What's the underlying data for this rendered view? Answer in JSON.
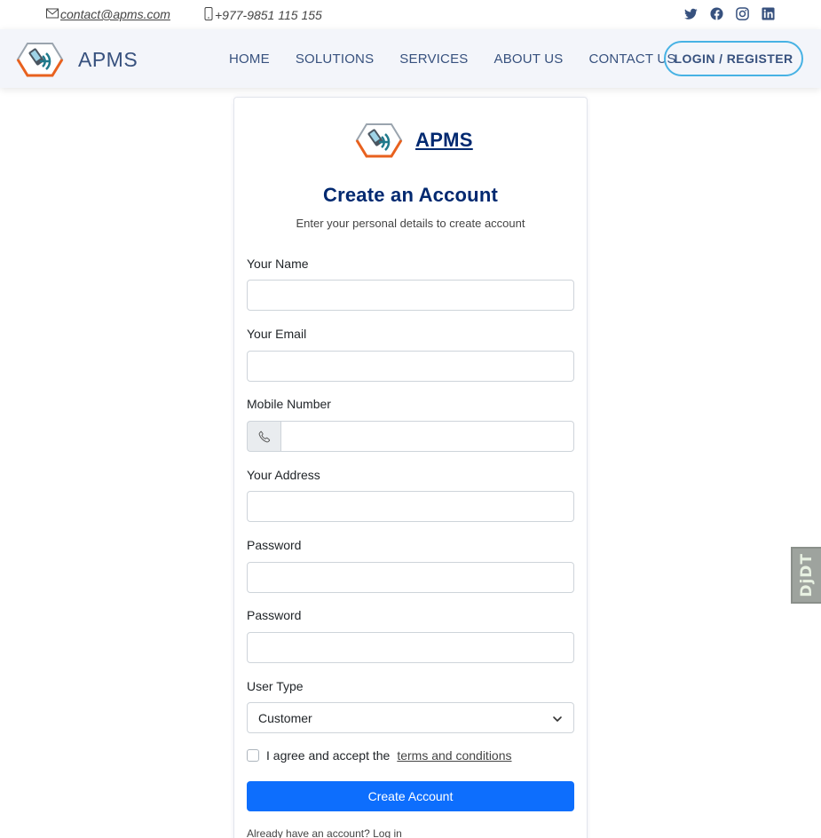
{
  "topbar": {
    "email": "contact@apms.com",
    "phone": "+977-9851 115 155",
    "socials": [
      "twitter-icon",
      "facebook-icon",
      "instagram-icon",
      "linkedin-icon"
    ]
  },
  "header": {
    "brand": "APMS",
    "nav": [
      "HOME",
      "SOLUTIONS",
      "SERVICES",
      "ABOUT US",
      "CONTACT US"
    ],
    "login_label": "LOGIN / REGISTER"
  },
  "card": {
    "brand": "APMS",
    "title": "Create an Account",
    "subtitle": "Enter your personal details to create account",
    "fields": {
      "name_label": "Your Name",
      "email_label": "Your Email",
      "mobile_label": "Mobile Number",
      "address_label": "Your Address",
      "password_label": "Password",
      "password2_label": "Password",
      "user_type_label": "User Type",
      "user_type_value": "Customer"
    },
    "agree_text": "I agree and accept the",
    "terms_link": "terms and conditions",
    "submit_label": "Create Account",
    "already_text": "Already have an account?",
    "login_link": "Log in"
  },
  "debug_toolbar": {
    "label": "DjDT"
  },
  "colors": {
    "primary": "#0d6efd",
    "brand_dark": "#37517e",
    "title": "#012970",
    "accent_border": "#47b2e4",
    "header_bg": "#f3f5fa"
  }
}
